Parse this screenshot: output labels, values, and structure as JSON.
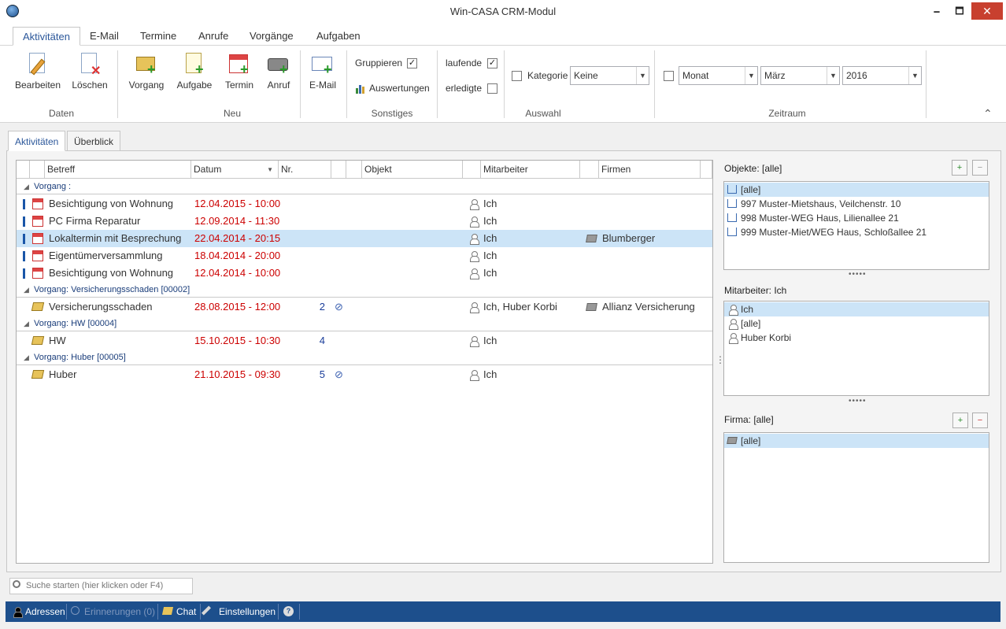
{
  "window": {
    "title": "Win-CASA CRM-Modul",
    "minimize": "🗕",
    "maximize": "🗖",
    "close": "✕"
  },
  "ribbon_tabs": [
    "Aktivitäten",
    "E-Mail",
    "Termine",
    "Anrufe",
    "Vorgänge",
    "Aufgaben"
  ],
  "ribbon": {
    "daten": {
      "label": "Daten",
      "bearbeiten": "Bearbeiten",
      "loeschen": "Löschen"
    },
    "neu": {
      "label": "Neu",
      "vorgang": "Vorgang",
      "aufgabe": "Aufgabe",
      "termin": "Termin",
      "anruf": "Anruf",
      "email": "E-Mail"
    },
    "sonstiges": {
      "label": "Sonstiges",
      "gruppieren": "Gruppieren",
      "gruppieren_checked": "✓",
      "auswertungen": "Auswertungen"
    },
    "auswahl": {
      "label": "Auswahl",
      "laufende": "laufende",
      "laufende_checked": "✓",
      "erledigte": "erledigte",
      "kategorie": "Kategorie",
      "kategorie_value": "Keine"
    },
    "zeitraum": {
      "label": "Zeitraum",
      "period": "Monat",
      "month": "März",
      "year": "2016"
    },
    "collapse_icon": "⌃"
  },
  "page_tabs": [
    "Aktivitäten",
    "Überblick"
  ],
  "grid": {
    "columns": [
      "Betreff",
      "Datum",
      "Nr.",
      "Objekt",
      "Mitarbeiter",
      "Firmen"
    ],
    "sort_indicator": "▼",
    "groups": [
      {
        "label": "Vorgang :",
        "rows": [
          {
            "betreff": "Besichtigung von Wohnung",
            "datum": "12.04.2015 - 10:00",
            "nr": "",
            "clip": false,
            "mitarbeiter": "Ich",
            "firma": "",
            "type": "termin"
          },
          {
            "betreff": "PC Firma Reparatur",
            "datum": "12.09.2014 - 11:30",
            "nr": "",
            "clip": false,
            "mitarbeiter": "Ich",
            "firma": "",
            "type": "termin"
          },
          {
            "betreff": "Lokaltermin mit Besprechung",
            "datum": "22.04.2014 - 20:15",
            "nr": "",
            "clip": false,
            "mitarbeiter": "Ich",
            "firma": "Blumberger",
            "type": "termin",
            "selected": true
          },
          {
            "betreff": "Eigentümerversammlung",
            "datum": "18.04.2014 - 20:00",
            "nr": "",
            "clip": false,
            "mitarbeiter": "Ich",
            "firma": "",
            "type": "termin"
          },
          {
            "betreff": "Besichtigung von Wohnung",
            "datum": "12.04.2014 - 10:00",
            "nr": "",
            "clip": false,
            "mitarbeiter": "Ich",
            "firma": "",
            "type": "termin"
          }
        ]
      },
      {
        "label": "Vorgang: Versicherungsschaden [00002]",
        "rows": [
          {
            "betreff": "Versicherungsschaden",
            "datum": "28.08.2015 - 12:00",
            "nr": "2",
            "clip": true,
            "mitarbeiter": "Ich, Huber Korbi",
            "firma": "Allianz Versicherung",
            "type": "vorgang"
          }
        ]
      },
      {
        "label": "Vorgang: HW [00004]",
        "rows": [
          {
            "betreff": "HW",
            "datum": "15.10.2015 - 10:30",
            "nr": "4",
            "clip": false,
            "mitarbeiter": "Ich",
            "firma": "",
            "type": "vorgang"
          }
        ]
      },
      {
        "label": "Vorgang: Huber [00005]",
        "rows": [
          {
            "betreff": "Huber",
            "datum": "21.10.2015 - 09:30",
            "nr": "5",
            "clip": true,
            "mitarbeiter": "Ich",
            "firma": "",
            "type": "vorgang"
          }
        ]
      }
    ]
  },
  "side": {
    "objekte": {
      "label": "Objekte: [alle]",
      "items": [
        "[alle]",
        "997 Muster-Mietshaus, Veilchenstr. 10",
        "998 Muster-WEG Haus, Lilienallee 21",
        "999 Muster-Miet/WEG Haus, Schloßallee 21"
      ]
    },
    "mitarbeiter": {
      "label": "Mitarbeiter: Ich",
      "items": [
        "Ich",
        "[alle]",
        "Huber Korbi"
      ]
    },
    "firma": {
      "label": "Firma: [alle]",
      "items": [
        "[alle]"
      ]
    },
    "grip": "•••••",
    "vgrip": "⋮"
  },
  "search": {
    "placeholder": "Suche starten (hier klicken oder F4)"
  },
  "statusbar": {
    "adressen": "Adressen",
    "erinnerungen": "Erinnerungen (0)",
    "chat": "Chat",
    "einstellungen": "Einstellungen",
    "help": "?"
  },
  "colors": {
    "accent": "#2b579a",
    "statusbar": "#1d4f8c",
    "date": "#cc0000",
    "selection": "#cce4f7",
    "close": "#c8402f"
  }
}
